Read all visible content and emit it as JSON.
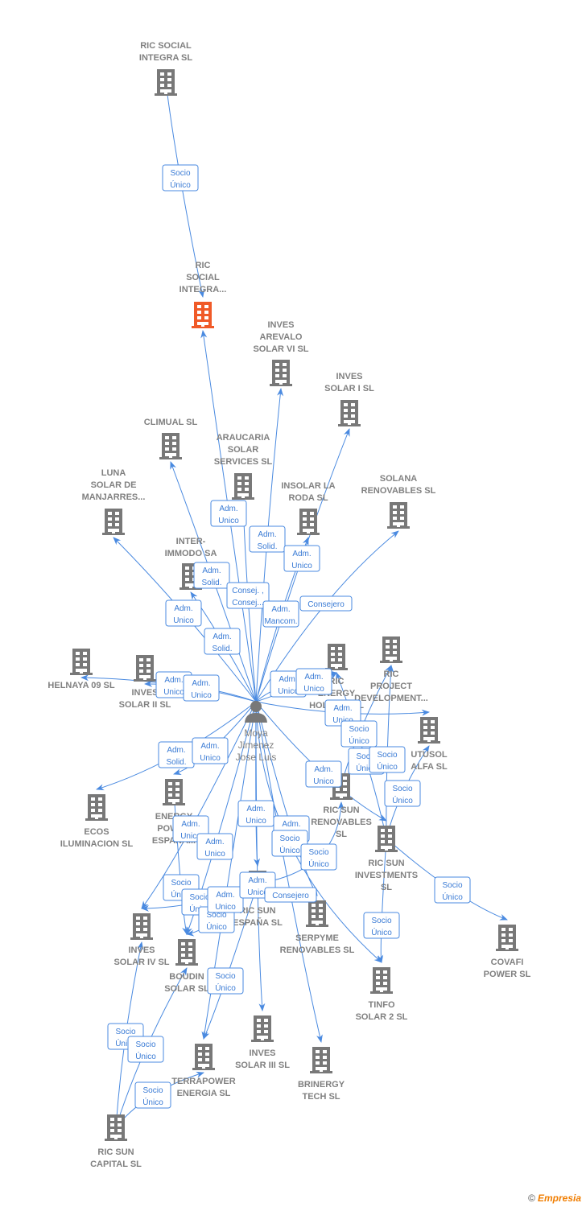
{
  "colors": {
    "node": "#787878",
    "highlight": "#f05a28",
    "edge": "#4a8ae0",
    "person": "#787878"
  },
  "person": {
    "id": "person",
    "label": [
      "Moya",
      "Jimenez",
      "Jose Luis"
    ],
    "icon": "person-icon"
  },
  "nodes": [
    {
      "id": "ric-social-integra-sl",
      "label": [
        "RIC SOCIAL",
        "INTEGRA  SL"
      ]
    },
    {
      "id": "ric-social-integra-main",
      "label": [
        "RIC",
        "SOCIAL",
        "INTEGRA..."
      ],
      "highlight": true
    },
    {
      "id": "inves-arevalo",
      "label": [
        "INVES",
        "AREVALO",
        "SOLAR VI SL"
      ]
    },
    {
      "id": "inves-solar-i",
      "label": [
        "INVES",
        "SOLAR I SL"
      ]
    },
    {
      "id": "climual",
      "label": [
        "CLIMUAL SL"
      ]
    },
    {
      "id": "araucaria",
      "label": [
        "ARAUCARIA",
        "SOLAR",
        "SERVICES SL"
      ]
    },
    {
      "id": "insolar",
      "label": [
        "INSOLAR LA",
        "RODA  SL"
      ]
    },
    {
      "id": "solana",
      "label": [
        "SOLANA",
        "RENOVABLES SL"
      ]
    },
    {
      "id": "luna",
      "label": [
        "LUNA",
        "SOLAR DE",
        "MANJARRES..."
      ]
    },
    {
      "id": "inter-immodo",
      "label": [
        "INTER-",
        "IMMODO SA"
      ]
    },
    {
      "id": "helnaya",
      "label": [
        "HELNAYA 09 SL"
      ]
    },
    {
      "id": "inves-solar-ii",
      "label": [
        "INVES",
        "SOLAR II SL"
      ]
    },
    {
      "id": "ric-energy",
      "label": [
        "RIC",
        "ENERGY",
        "HOLDING SL"
      ]
    },
    {
      "id": "ric-project",
      "label": [
        "RIC",
        "PROJECT",
        "DEVELOPMENT..."
      ]
    },
    {
      "id": "utusol",
      "label": [
        "UTUSOL",
        "ALFA  SL"
      ]
    },
    {
      "id": "ric-sun-renovables",
      "label": [
        "RIC SUN",
        "RENOVABLES",
        "SL"
      ]
    },
    {
      "id": "ric-sun-investments",
      "label": [
        "RIC SUN",
        "INVESTMENTS",
        "SL"
      ]
    },
    {
      "id": "covafi",
      "label": [
        "COVAFI",
        "POWER  SL"
      ]
    },
    {
      "id": "ecos",
      "label": [
        "ECOS",
        "ILUMINACION SL"
      ]
    },
    {
      "id": "energy-power",
      "label": [
        "ENERGY",
        "POWER",
        "ESPAÑA..."
      ]
    },
    {
      "id": "ric-sun-espana",
      "label": [
        "RIC SUN",
        "ESPAÑA  SL"
      ]
    },
    {
      "id": "serpyme",
      "label": [
        "SERPYME",
        "RENOVABLES SL"
      ]
    },
    {
      "id": "inves-solar-iv",
      "label": [
        "INVES",
        "SOLAR IV SL"
      ]
    },
    {
      "id": "boudin",
      "label": [
        "BOUDIN",
        "SOLAR SL"
      ]
    },
    {
      "id": "tinfo",
      "label": [
        "TINFO",
        "SOLAR 2 SL"
      ]
    },
    {
      "id": "inves-solar-iii",
      "label": [
        "INVES",
        "SOLAR III SL"
      ]
    },
    {
      "id": "terrapower",
      "label": [
        "TERRAPOWER",
        "ENERGIA  SL"
      ]
    },
    {
      "id": "brinergy",
      "label": [
        "BRINERGY",
        "TECH  SL"
      ]
    },
    {
      "id": "ric-sun-capital",
      "label": [
        "RIC SUN",
        "CAPITAL  SL"
      ]
    }
  ],
  "edges": [
    {
      "from": "ric-social-integra-sl",
      "to": "ric-social-integra-main",
      "label": [
        "Socio",
        "Único"
      ]
    },
    {
      "from": "person",
      "to": "ric-social-integra-main",
      "label": [
        "Adm.",
        "Unico"
      ]
    },
    {
      "from": "person",
      "to": "inves-arevalo",
      "label": [
        "Adm.",
        "Solid."
      ]
    },
    {
      "from": "person",
      "to": "inves-solar-i",
      "label": [
        "Adm.",
        "Unico"
      ]
    },
    {
      "from": "person",
      "to": "climual",
      "label": [
        "Adm.",
        "Solid."
      ]
    },
    {
      "from": "person",
      "to": "araucaria",
      "label": [
        "Consej. ,",
        "Consej..."
      ]
    },
    {
      "from": "person",
      "to": "insolar",
      "label": [
        "Adm.",
        "Mancom."
      ]
    },
    {
      "from": "person",
      "to": "solana",
      "label": [
        "Consejero"
      ]
    },
    {
      "from": "person",
      "to": "luna",
      "label": [
        "Adm.",
        "Unico"
      ]
    },
    {
      "from": "person",
      "to": "inter-immodo",
      "label": [
        "Adm.",
        "Solid."
      ]
    },
    {
      "from": "person",
      "to": "helnaya",
      "label": [
        "Adm.",
        "Unico"
      ]
    },
    {
      "from": "person",
      "to": "inves-solar-ii",
      "label": [
        "Adm.",
        "Unico"
      ]
    },
    {
      "from": "person",
      "to": "ric-energy",
      "label": [
        "Adm.",
        "Unico"
      ]
    },
    {
      "from": "person",
      "to": "ric-energy",
      "label": [
        "Adm.",
        "Unico"
      ]
    },
    {
      "from": "person",
      "to": "utusol",
      "label": [
        "Adm.",
        "Unico"
      ]
    },
    {
      "from": "ric-sun-renovables",
      "to": "ric-project",
      "label": [
        "Socio",
        "Único"
      ]
    },
    {
      "from": "ric-sun-investments",
      "to": "ric-energy",
      "label": [
        "Socio",
        "Único"
      ]
    },
    {
      "from": "ric-sun-investments",
      "to": "ric-project",
      "label": [
        "Socio",
        "Único"
      ]
    },
    {
      "from": "ric-sun-investments",
      "to": "utusol",
      "label": [
        "Socio",
        "Único"
      ]
    },
    {
      "from": "person",
      "to": "ric-sun-investments",
      "label": [
        "Adm.",
        "Unico"
      ]
    },
    {
      "from": "person",
      "to": "ecos",
      "label": [
        "Adm.",
        "Solid."
      ]
    },
    {
      "from": "person",
      "to": "energy-power",
      "label": [
        "Adm.",
        "Unico"
      ]
    },
    {
      "from": "person",
      "to": "inves-solar-iv",
      "label": [
        "Adm.",
        "Unico"
      ]
    },
    {
      "from": "person",
      "to": "boudin",
      "label": [
        "Adm.",
        "Unico"
      ]
    },
    {
      "from": "person",
      "to": "ric-sun-espana",
      "label": [
        "Adm.",
        "Unico"
      ]
    },
    {
      "from": "person",
      "to": "serpyme",
      "label": [
        "Adm.",
        "Unico"
      ]
    },
    {
      "from": "person",
      "to": "tinfo",
      "label": [
        "Socio",
        "Único"
      ]
    },
    {
      "from": "ric-sun-espana",
      "to": "ric-sun-renovables",
      "label": [
        "Socio",
        "Único"
      ]
    },
    {
      "from": "energy-power",
      "to": "boudin",
      "label": [
        "Socio",
        "Único"
      ]
    },
    {
      "from": "ric-sun-espana",
      "to": "inves-solar-iv",
      "label": [
        "Socio",
        "Único"
      ]
    },
    {
      "from": "ric-sun-espana",
      "to": "boudin",
      "label": [
        "Socio",
        "Único"
      ]
    },
    {
      "from": "person",
      "to": "terrapower",
      "label": [
        "Adm.",
        "Unico"
      ]
    },
    {
      "from": "person",
      "to": "inves-solar-iii",
      "label": [
        "Adm.",
        "Unico"
      ]
    },
    {
      "from": "person",
      "to": "brinergy",
      "label": [
        "Consejero"
      ]
    },
    {
      "from": "ric-sun-investments",
      "to": "covafi",
      "label": [
        "Socio",
        "Único"
      ]
    },
    {
      "from": "ric-sun-investments",
      "to": "tinfo",
      "label": [
        "Socio",
        "Único"
      ]
    },
    {
      "from": "ric-sun-espana",
      "to": "terrapower",
      "label": [
        "Socio",
        "Único"
      ]
    },
    {
      "from": "ric-sun-capital",
      "to": "inves-solar-iv",
      "label": [
        "Socio",
        "Único"
      ]
    },
    {
      "from": "ric-sun-capital",
      "to": "boudin",
      "label": [
        "Socio",
        "Único"
      ]
    },
    {
      "from": "ric-sun-capital",
      "to": "terrapower",
      "label": [
        "Socio",
        "Único"
      ]
    }
  ],
  "footer": {
    "copyright": "©",
    "brand": "Empresia"
  }
}
